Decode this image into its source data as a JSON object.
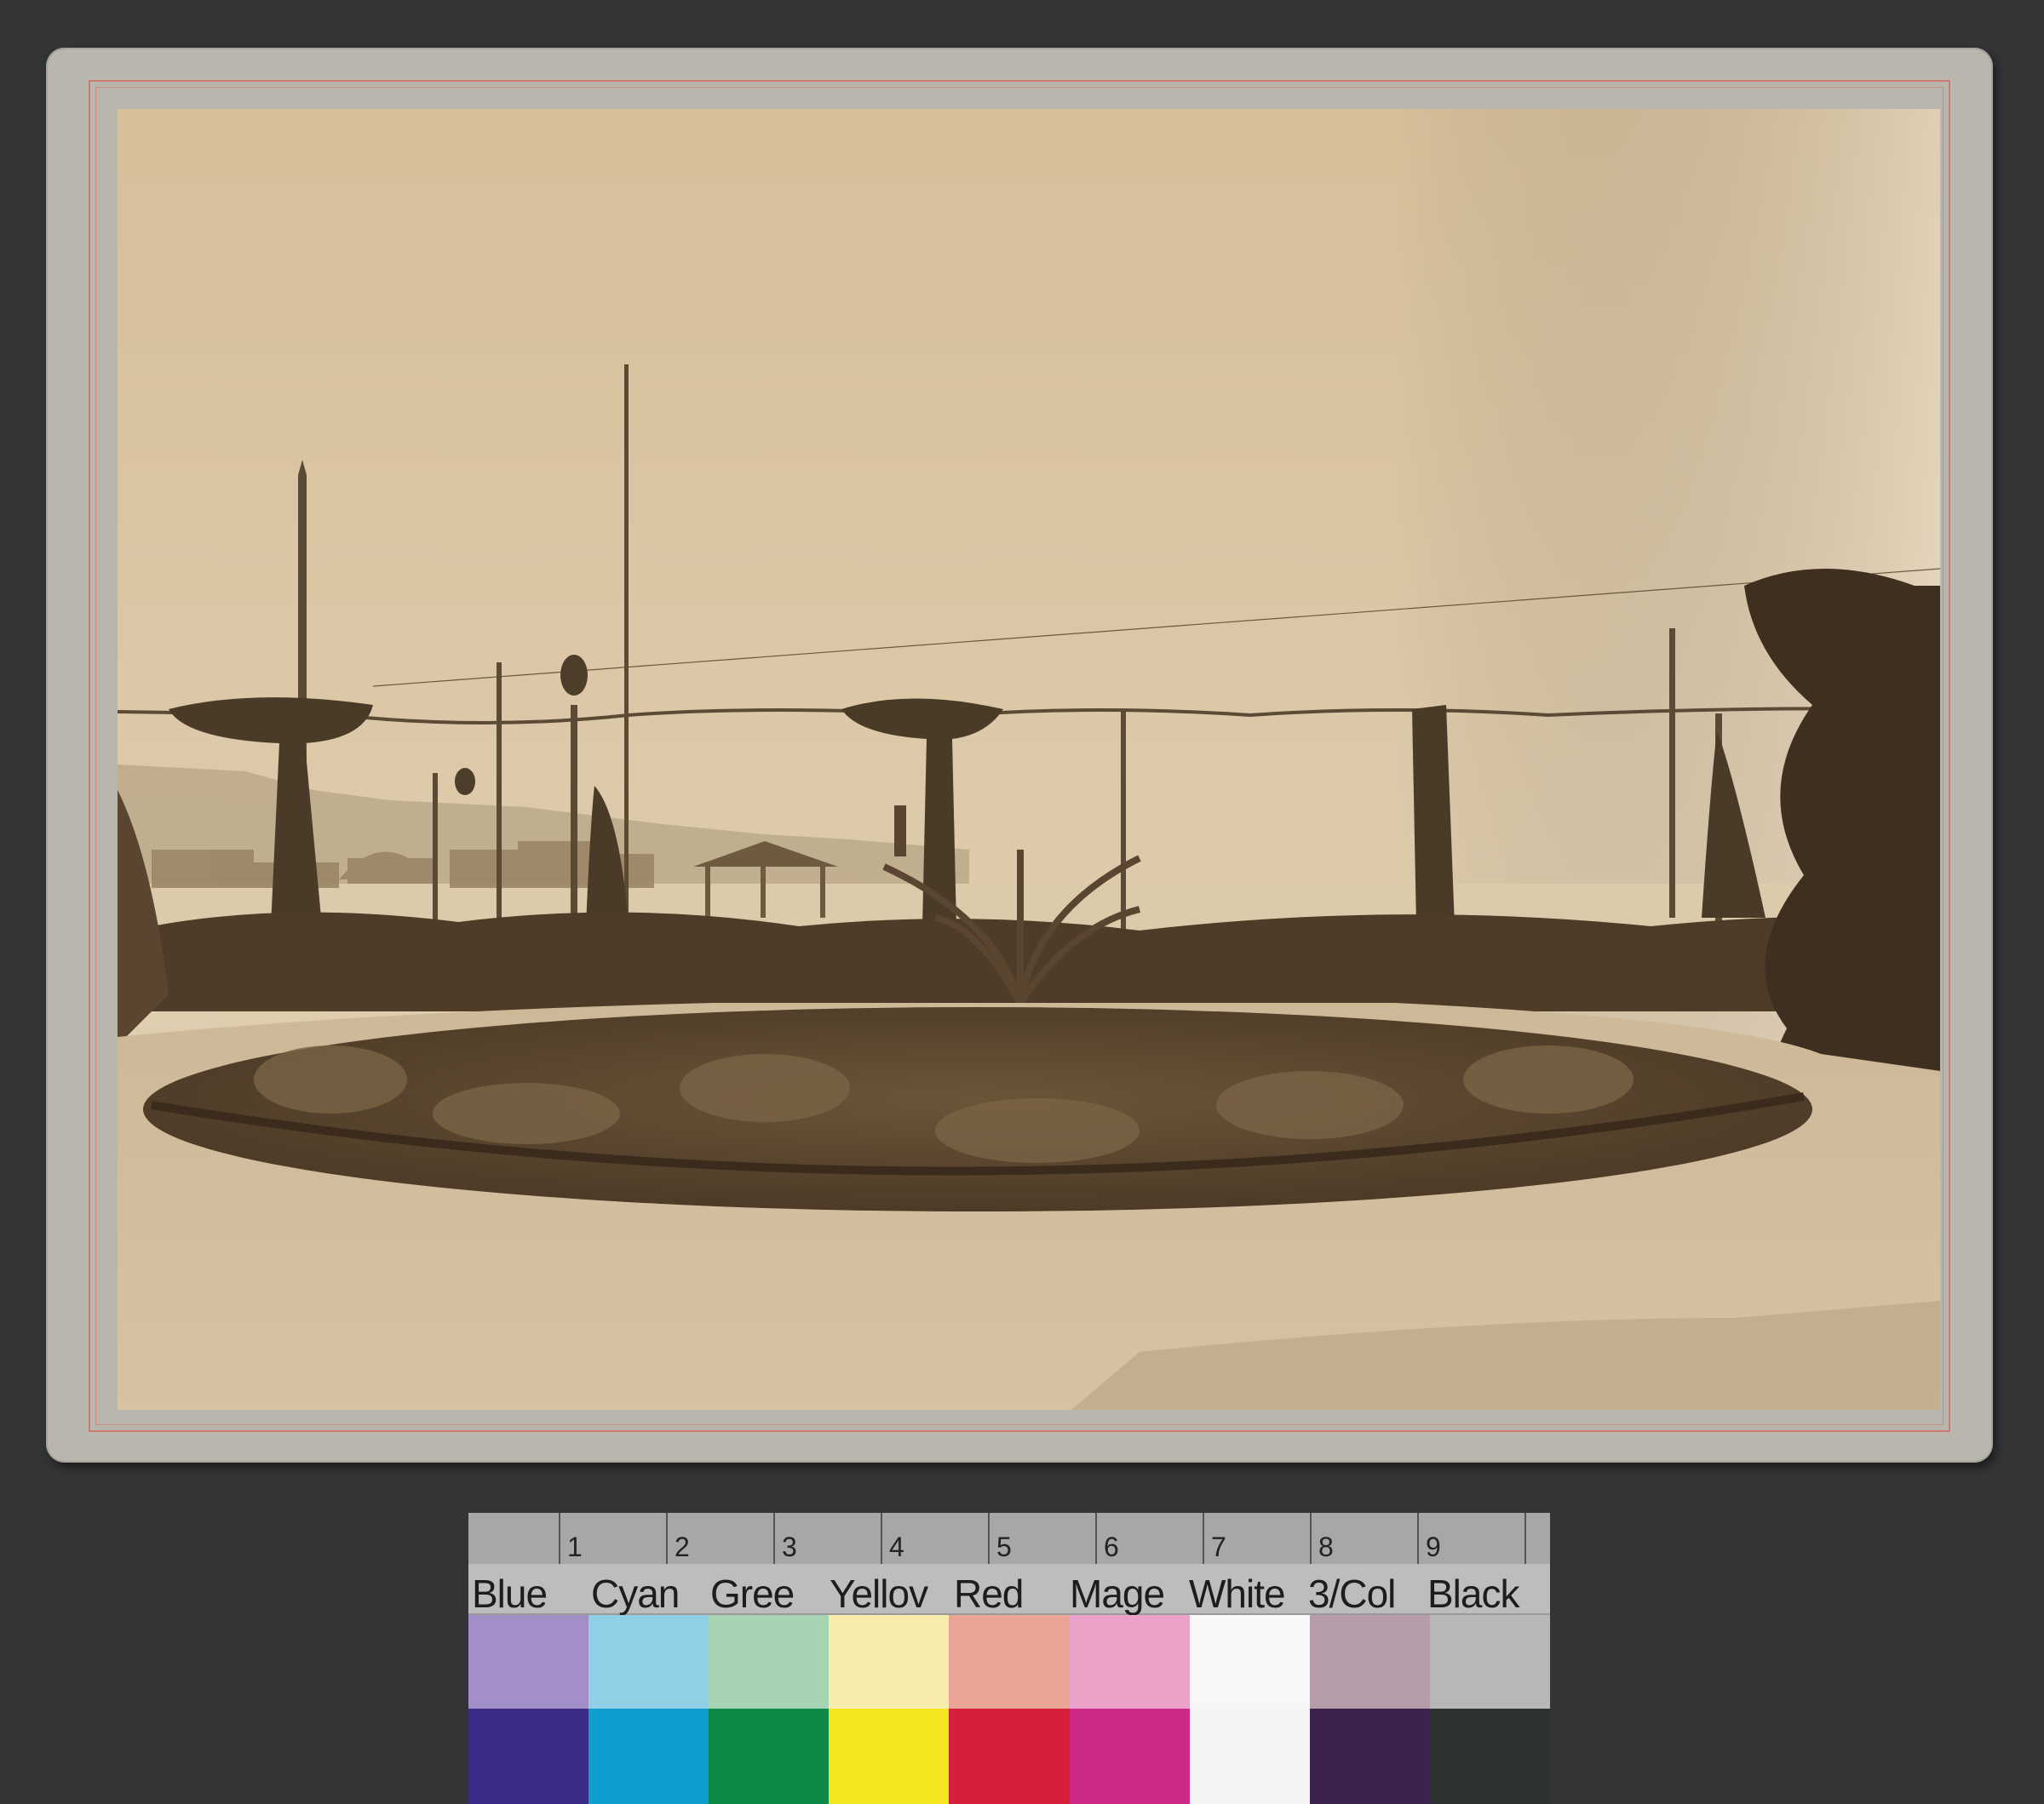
{
  "scene": {
    "description_colors": {
      "background": "#333436",
      "mount": "#b9b6ad",
      "mount_rule": "#cf7b6c",
      "sepia_sky": "#dcc6a2",
      "sepia_ground": "#c9b393",
      "foliage": "#4a3826"
    }
  },
  "color_checker": {
    "ruler_numbers": [
      "1",
      "2",
      "3",
      "4",
      "5",
      "6",
      "7",
      "8",
      "9"
    ],
    "patches": [
      {
        "label": "Blue",
        "top": "#a38ec7",
        "bottom": "#3a2b86"
      },
      {
        "label": "Cyan",
        "top": "#8fd0e6",
        "bottom": "#0f9fcf"
      },
      {
        "label": "Gree",
        "top": "#a6d4b3",
        "bottom": "#0d8a45"
      },
      {
        "label": "Yellov",
        "top": "#f7ecab",
        "bottom": "#f4e51c"
      },
      {
        "label": "Red",
        "top": "#eba596",
        "bottom": "#d81f3a"
      },
      {
        "label": "Mage",
        "top": "#eba2c9",
        "bottom": "#cc2a86"
      },
      {
        "label": "White",
        "top": "#f7f7f7",
        "bottom": "#f4f4f4"
      },
      {
        "label": "3/Col",
        "top": "#b49da9",
        "bottom": "#3b234c"
      },
      {
        "label": "Black",
        "top": "#b7b7b7",
        "bottom": "#2c3331"
      }
    ]
  }
}
